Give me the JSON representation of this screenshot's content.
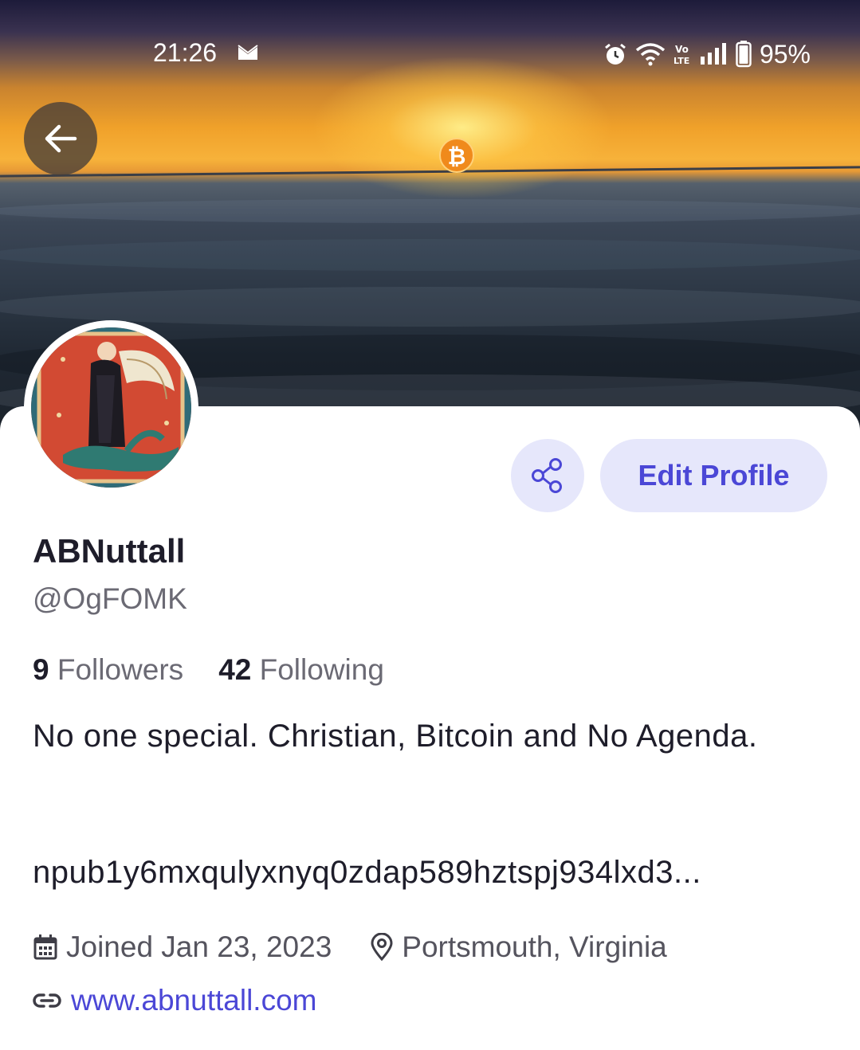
{
  "status_bar": {
    "time": "21:26",
    "battery": "95%",
    "network": "LTE"
  },
  "icons": {
    "back": "arrow-left-icon",
    "share": "share-icon",
    "calendar": "calendar-icon",
    "location": "location-pin-icon",
    "link": "link-icon",
    "bitcoin": "bitcoin-icon"
  },
  "colors": {
    "accent": "#4b47d6",
    "button_bg": "#e6e7fb",
    "text_primary": "#1e1d2a",
    "text_secondary": "#6b6a74"
  },
  "profile": {
    "display_name": "ABNuttall",
    "handle": "@OgFOMK",
    "followers_count": "9",
    "followers_label": "Followers",
    "following_count": "42",
    "following_label": "Following",
    "bio": "No one special. Christian, Bitcoin and No Agenda.",
    "npub": "npub1y6mxqulyxnyq0zdap589hztspj934lxd3...",
    "joined": "Joined Jan 23, 2023",
    "location": "Portsmouth, Virginia",
    "website": "www.abnuttall.com"
  },
  "actions": {
    "edit_profile_label": "Edit Profile"
  }
}
